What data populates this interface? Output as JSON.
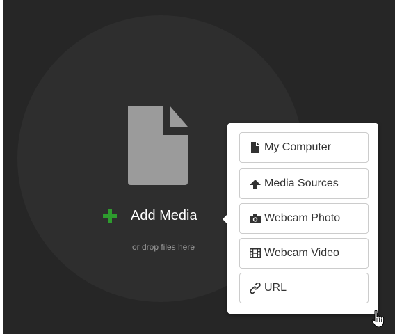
{
  "drop_zone": {
    "add_media_label": "Add Media",
    "drop_hint": "or drop files here"
  },
  "source_menu": {
    "items": [
      {
        "label": "My Computer",
        "icon": "file-icon"
      },
      {
        "label": "Media Sources",
        "icon": "cloud-upload-icon"
      },
      {
        "label": "Webcam Photo",
        "icon": "camera-icon"
      },
      {
        "label": "Webcam Video",
        "icon": "film-icon"
      },
      {
        "label": "URL",
        "icon": "link-icon"
      }
    ]
  },
  "colors": {
    "background": "#262626",
    "drop_circle": "#2e2e2e",
    "file_icon": "#9b9b9b",
    "plus_icon": "#2e9b2e",
    "menu_text": "#333333"
  }
}
